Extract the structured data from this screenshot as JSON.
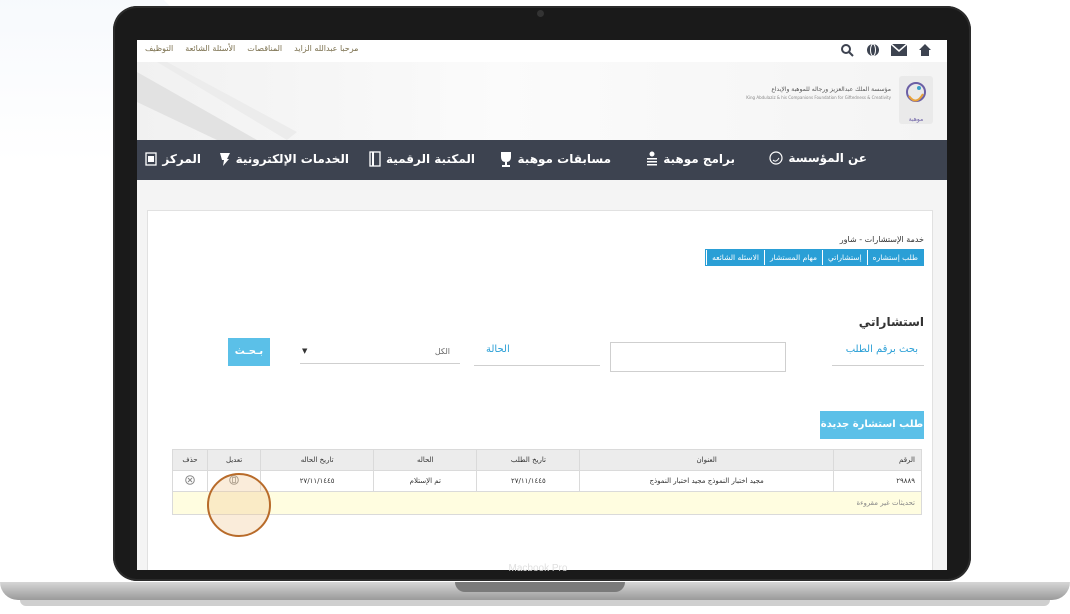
{
  "device": {
    "model_label": "Macbook Pro"
  },
  "topbar": {
    "links": [
      "مرحبا عبدالله الزايد",
      "المناقصات",
      "الأسئلة الشائعة",
      "التوظيف"
    ],
    "icons": [
      "search-icon",
      "globe-icon",
      "mail-icon",
      "home-icon"
    ]
  },
  "header": {
    "org_name_ar": "مؤسسة الملك عبدالعزيز ورجاله للموهبة والإبداع",
    "org_name_en": "King Abdulaziz & his Companions Foundation for Giftedness & Creativity",
    "logo_caption": "موهبة"
  },
  "nav": {
    "items": [
      {
        "label": "عن المؤسسة",
        "icon": "foundation-icon"
      },
      {
        "label": "برامج موهبة",
        "icon": "programs-icon"
      },
      {
        "label": "مسابقات موهبة",
        "icon": "trophy-icon"
      },
      {
        "label": "المكتبة الرقمية",
        "icon": "library-icon"
      },
      {
        "label": "الخدمات الإلكترونية",
        "icon": "services-icon"
      },
      {
        "label": "المركز",
        "icon": "center-icon"
      }
    ]
  },
  "service": {
    "title": "خدمة الإستشارات - شاور",
    "tabs": [
      "طلب إستشاره",
      "إستشاراتي",
      "مهام المستشار",
      "الاسئله الشائعه"
    ]
  },
  "search": {
    "heading": "استشاراتي",
    "request_number_label": "بحث برقم الطلب",
    "request_number_value": "",
    "status_label": "الحالة",
    "status_selected": "الكل",
    "search_button": "بـحـث",
    "new_button": "طلب استشارة جديدة"
  },
  "table": {
    "headers": [
      "الرقم",
      "العنوان",
      "تاريخ الطلب",
      "الحاله",
      "تاريخ الحاله",
      "تعديل",
      "حذف"
    ],
    "rows": [
      {
        "number": "٢٩٨٨٩",
        "title": "مجيد اختبار النموذج مجيد اختبار النموذج",
        "request_date": "٢٧/١١/١٤٤٥",
        "status": "تم الإستلام",
        "status_date": "٢٧/١١/١٤٤٥"
      }
    ],
    "note": "تحديثات غير مقروءة"
  }
}
